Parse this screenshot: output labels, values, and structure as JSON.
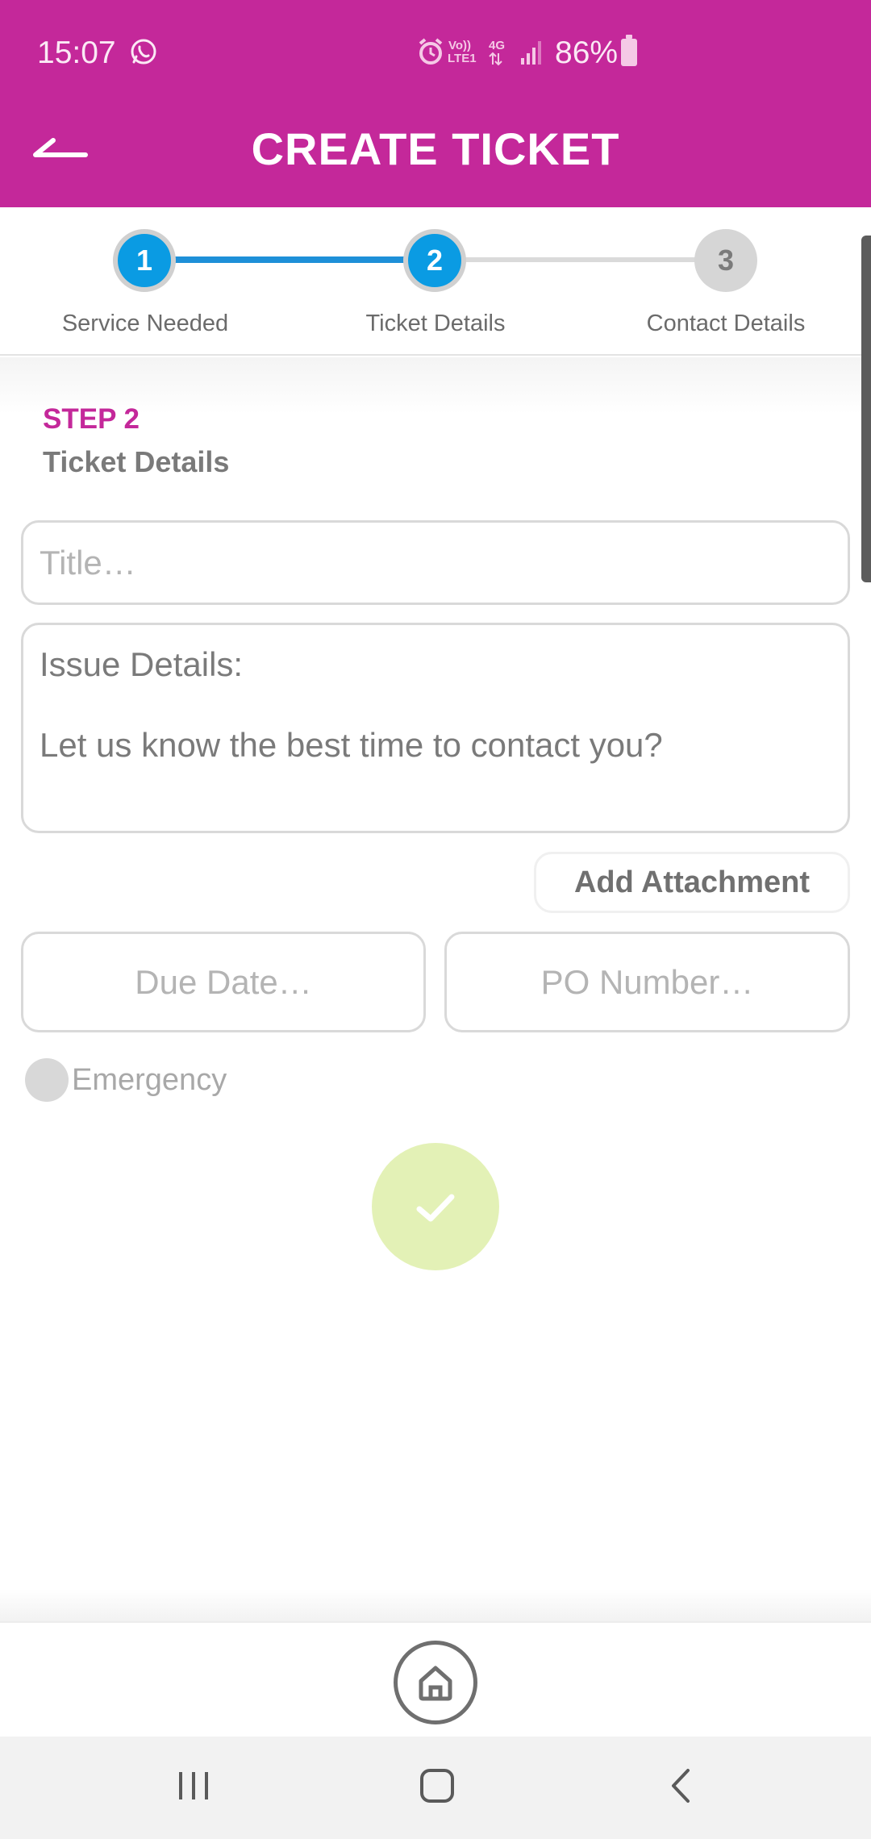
{
  "status_bar": {
    "time": "15:07",
    "battery_percent": "86%",
    "network": "4G",
    "volte": "VoLTE1",
    "icons": [
      "whatsapp-icon",
      "alarm-icon",
      "volte-icon",
      "4g-icon",
      "signal-icon",
      "battery-icon"
    ]
  },
  "header": {
    "title": "CREATE TICKET",
    "back_icon": "back-arrow-icon"
  },
  "stepper": {
    "current_step": 2,
    "steps": [
      {
        "number": "1",
        "label": "Service Needed",
        "state": "done"
      },
      {
        "number": "2",
        "label": "Ticket Details",
        "state": "active"
      },
      {
        "number": "3",
        "label": "Contact Details",
        "state": "todo"
      }
    ]
  },
  "form": {
    "step_kicker": "STEP 2",
    "step_title": "Ticket Details",
    "title_placeholder": "Title…",
    "details_line1": "Issue Details:",
    "details_line2": "Let us know the best time to contact you?",
    "attach_label": "Add Attachment",
    "due_date_placeholder": "Due Date…",
    "po_number_placeholder": "PO Number…",
    "emergency_label": "Emergency",
    "emergency_checked": false
  },
  "colors": {
    "brand": "#c4289a",
    "step_active": "#0a9be3",
    "submit": "#e3f1b6"
  },
  "bottom_bar": {
    "home_icon": "home-icon"
  },
  "nav_bar": {
    "icons": [
      "recent-apps-icon",
      "home-nav-icon",
      "back-nav-icon"
    ]
  }
}
